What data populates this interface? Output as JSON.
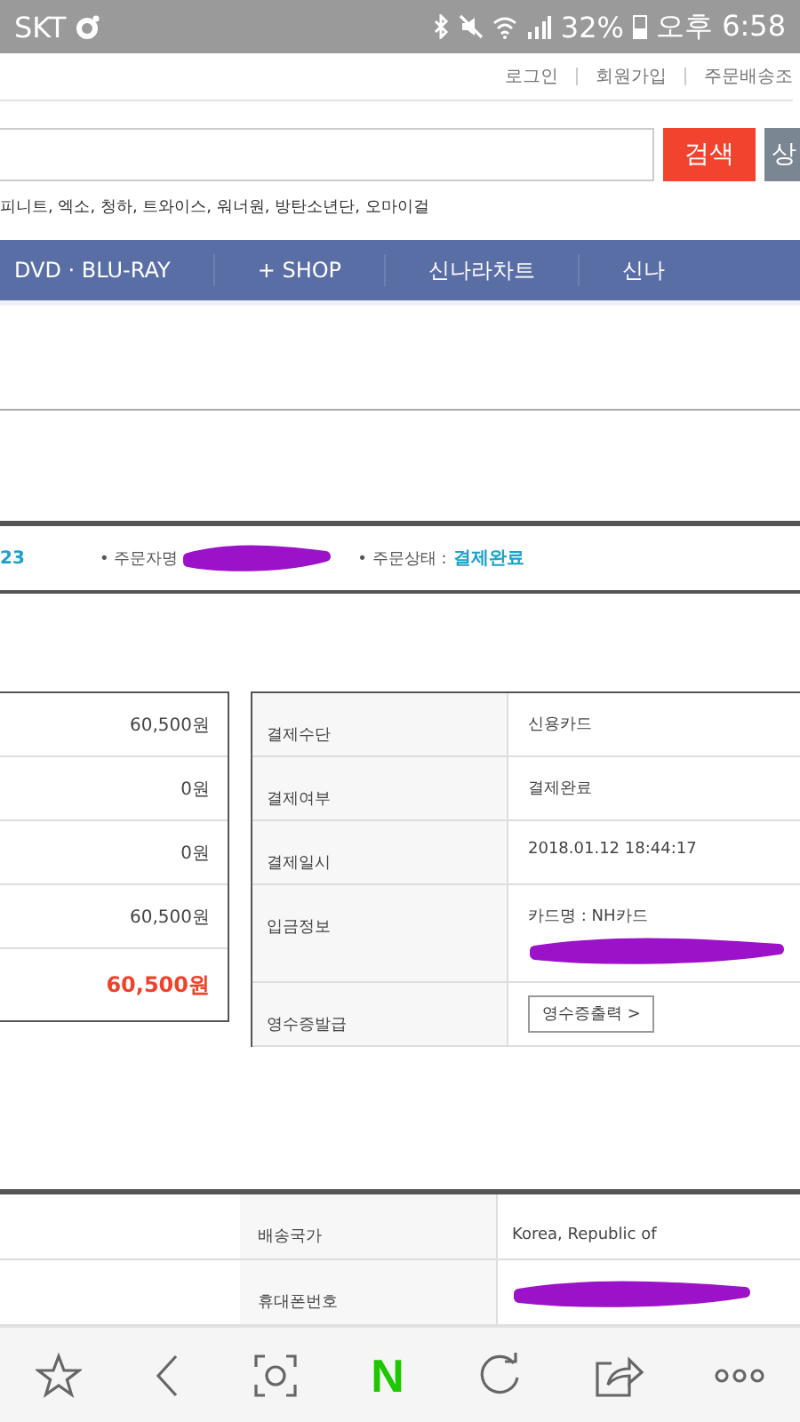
{
  "status_bar": {
    "carrier": "SKT",
    "battery": "32%",
    "time": "오후 6:58"
  },
  "top_links": [
    "로그인",
    "회원가입",
    "주문배송조"
  ],
  "search": {
    "button": "검색",
    "second_button": "상"
  },
  "popular_keywords": "피니트, 엑소, 청하, 트와이스, 워너원, 방탄소년단, 오마이걸",
  "nav": [
    "DVD · BLU-RAY",
    "+ SHOP",
    "신나라차트",
    "신나"
  ],
  "order_info": {
    "order_number": "23",
    "orderer_label": "• 주문자명",
    "orderer_redacted": true,
    "status_label": "• 주문상태 :",
    "status": "결제완료"
  },
  "payment_amounts": [
    {
      "value": "60,500원",
      "kind": "normal"
    },
    {
      "value": "0원",
      "kind": "normal"
    },
    {
      "value": "0원",
      "kind": "normal"
    },
    {
      "value": "60,500원",
      "kind": "normal"
    },
    {
      "value": "60,500원",
      "kind": "total"
    }
  ],
  "payment_details": [
    {
      "label": "결제수단",
      "value": "신용카드",
      "redacted": false
    },
    {
      "label": "결제여부",
      "value": "결제완료",
      "redacted": false
    },
    {
      "label": "결제일시",
      "value": "2018.01.12 18:44:17",
      "redacted": false
    },
    {
      "label": "입금정보",
      "value": "카드명 : NH카드",
      "redacted": true
    },
    {
      "label": "영수증발급",
      "button": "영수증출력 >",
      "redacted": false
    }
  ],
  "shipping": [
    {
      "label": "배송국가",
      "value": "Korea, Republic of",
      "redacted": false
    },
    {
      "label": "휴대폰번호",
      "redacted": true
    }
  ],
  "browser_toolbar": {
    "home_logo": "N"
  }
}
